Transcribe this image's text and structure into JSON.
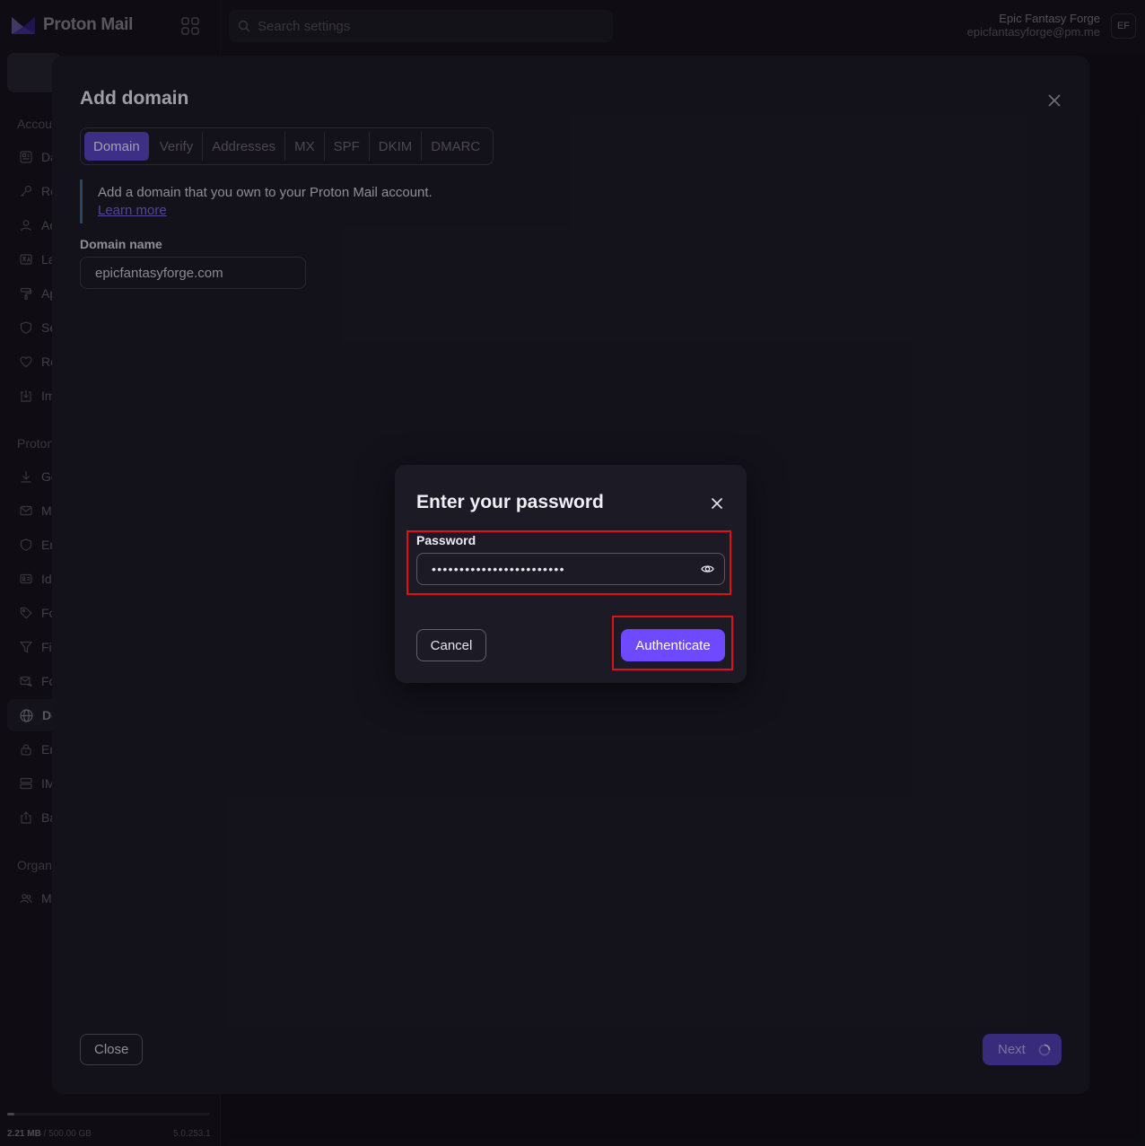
{
  "app": {
    "logo_text": "Proton Mail"
  },
  "search": {
    "placeholder": "Search settings"
  },
  "user": {
    "name": "Epic Fantasy Forge",
    "email": "epicfantasyforge@pm.me",
    "initials": "EF"
  },
  "sidebar": {
    "section_account": "Accou",
    "section_proton": "Proton",
    "section_org": "Organ",
    "items": [
      {
        "label": "Da",
        "icon": "dashboard-icon"
      },
      {
        "label": "Re",
        "icon": "key-icon"
      },
      {
        "label": "Ac",
        "icon": "user-icon"
      },
      {
        "label": "La",
        "icon": "language-icon"
      },
      {
        "label": "Ap",
        "icon": "paint-roller-icon"
      },
      {
        "label": "Se",
        "icon": "shield-icon"
      },
      {
        "label": "Re",
        "icon": "heart-icon"
      },
      {
        "label": "Im",
        "icon": "import-icon"
      },
      {
        "label": "Ge",
        "icon": "download-icon"
      },
      {
        "label": "M",
        "icon": "envelope-icon"
      },
      {
        "label": "En",
        "icon": "shield-icon"
      },
      {
        "label": "Id",
        "icon": "id-card-icon"
      },
      {
        "label": "Fo",
        "icon": "tag-icon"
      },
      {
        "label": "Fi",
        "icon": "filter-icon"
      },
      {
        "label": "Fo",
        "icon": "forward-icon"
      },
      {
        "label": "Do",
        "icon": "globe-icon"
      },
      {
        "label": "En",
        "icon": "lock-icon"
      },
      {
        "label": "IM",
        "icon": "server-icon"
      },
      {
        "label": "Ba",
        "icon": "export-icon"
      },
      {
        "label": "M",
        "icon": "users-icon"
      }
    ],
    "storage_used": "2.21 MB",
    "storage_total": " / 500.00 GB",
    "storage_fraction": 0.004,
    "version": "5.0.253.1"
  },
  "add_domain": {
    "title": "Add domain",
    "steps": [
      "Domain",
      "Verify",
      "Addresses",
      "MX",
      "SPF",
      "DKIM",
      "DMARC"
    ],
    "active_step": "Domain",
    "info_text": "Add a domain that you own to your Proton Mail account.",
    "learn_more": "Learn more",
    "domain_label": "Domain name",
    "domain_value": "epicfantasyforge.com",
    "close_label": "Close",
    "next_label": "Next"
  },
  "password_dialog": {
    "title": "Enter your password",
    "password_label": "Password",
    "password_mask": "••••••••••••••••••••••••",
    "cancel_label": "Cancel",
    "authenticate_label": "Authenticate"
  },
  "colors": {
    "accent": "#6d4aff",
    "highlight": "#e0101a"
  }
}
